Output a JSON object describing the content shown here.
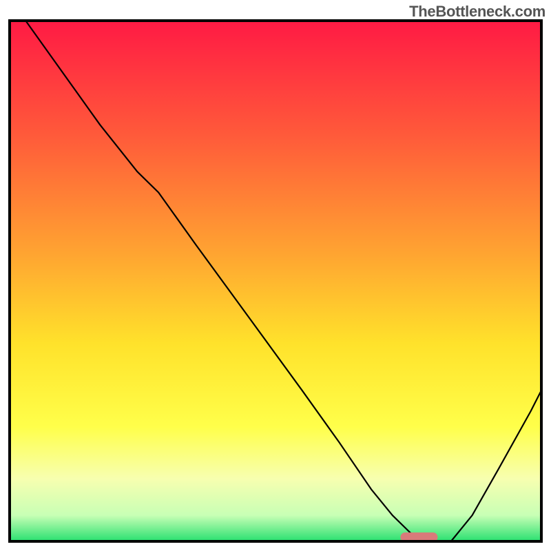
{
  "watermark": "TheBottleneck.com",
  "chart_data": {
    "type": "line",
    "title": "",
    "xlabel": "",
    "ylabel": "",
    "xlim": [
      0,
      100
    ],
    "ylim": [
      0,
      100
    ],
    "gradient_stops": [
      {
        "offset": 0,
        "color": "#ff1a44"
      },
      {
        "offset": 22,
        "color": "#ff5a3a"
      },
      {
        "offset": 45,
        "color": "#ffa531"
      },
      {
        "offset": 62,
        "color": "#ffe22b"
      },
      {
        "offset": 78,
        "color": "#ffff4a"
      },
      {
        "offset": 88,
        "color": "#f7ffb0"
      },
      {
        "offset": 95,
        "color": "#c8ffb5"
      },
      {
        "offset": 100,
        "color": "#28e070"
      }
    ],
    "series": [
      {
        "name": "bottleneck-curve",
        "color": "#000000",
        "width": 2.2,
        "x": [
          3,
          10,
          17,
          24,
          28,
          35,
          45,
          55,
          62,
          68,
          72,
          76,
          80,
          83,
          87,
          92,
          98,
          100
        ],
        "values": [
          100,
          90,
          80,
          71,
          67,
          57,
          43,
          29,
          19,
          10,
          5,
          1,
          0,
          0,
          5,
          14,
          25,
          29
        ]
      }
    ],
    "marker": {
      "name": "optimal-marker",
      "color": "#d97a7a",
      "x_center": 77,
      "y": 0.8,
      "width": 7,
      "height": 1.8
    },
    "frame_color": "#000000",
    "frame_width": 4
  }
}
